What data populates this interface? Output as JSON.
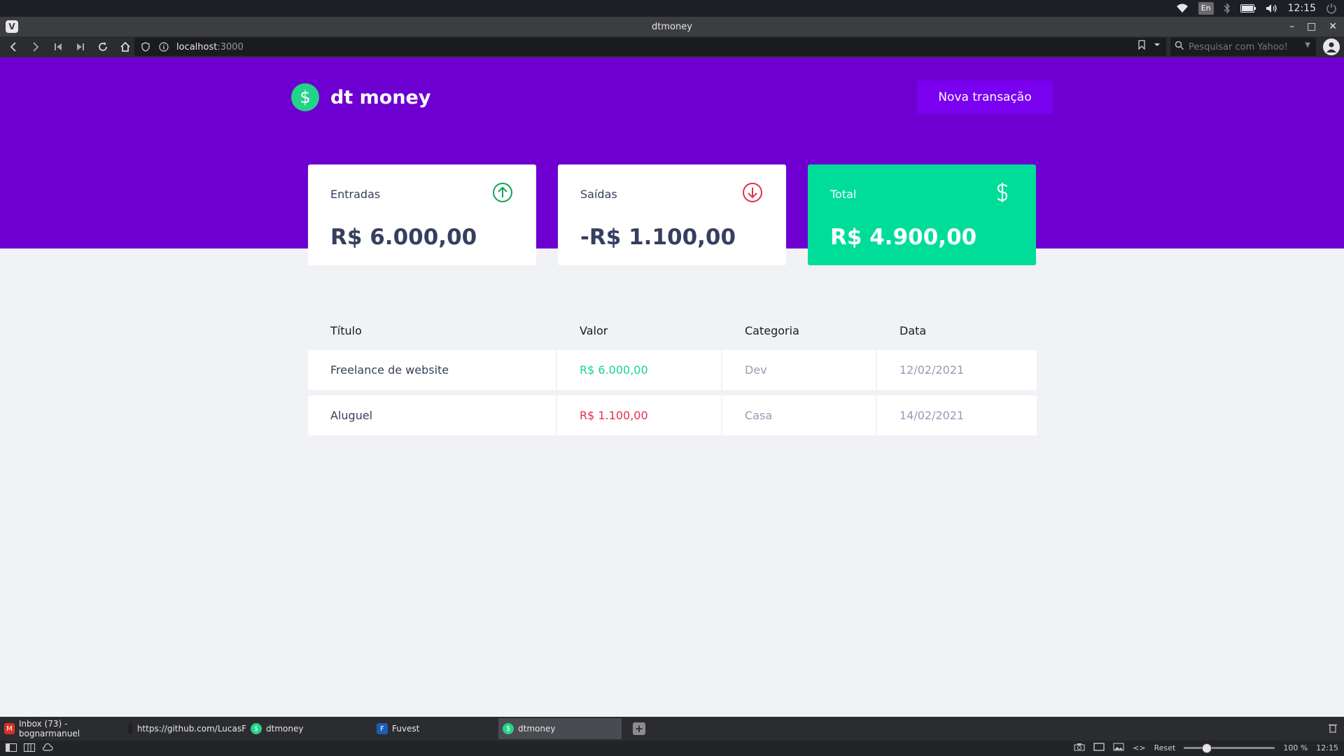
{
  "os": {
    "lang": "En",
    "clock": "12:15"
  },
  "browser": {
    "window_title": "dtmoney",
    "url_host": "localhost",
    "url_port": ":3000",
    "search_placeholder": "Pesquisar com Yahoo!"
  },
  "app": {
    "brand": "dt money",
    "new_transaction_label": "Nova transação",
    "summary": {
      "income": {
        "label": "Entradas",
        "value": "R$ 6.000,00",
        "icon": "arrow-up-circle-icon",
        "color": "#33cc95"
      },
      "outcome": {
        "label": "Saídas",
        "value": "-R$ 1.100,00",
        "icon": "arrow-down-circle-icon",
        "color": "#e52e4d"
      },
      "total": {
        "label": "Total",
        "value": "R$ 4.900,00",
        "icon": "dollar-sign-icon",
        "color": "#00dd99"
      }
    },
    "table": {
      "headers": [
        "Título",
        "Valor",
        "Categoria",
        "Data"
      ],
      "rows": [
        {
          "title": "Freelance de website",
          "amount": "R$ 6.000,00",
          "category": "Dev",
          "date": "12/02/2021",
          "type": "deposit"
        },
        {
          "title": "Aluguel",
          "amount": "R$ 1.100,00",
          "category": "Casa",
          "date": "14/02/2021",
          "type": "withdraw"
        }
      ]
    },
    "colors": {
      "header_purple": "#6d00d0",
      "button_purple": "#7a00f0",
      "green": "#00dd99",
      "red": "#e52e4d",
      "background": "#f0f2f5"
    }
  },
  "tabs": [
    {
      "label": "Inbox (73) - bognarmanuel",
      "icon": "gmail-icon"
    },
    {
      "label": "https://github.com/LucasF",
      "icon": "github-icon"
    },
    {
      "label": "dtmoney",
      "icon": "dtmoney-icon"
    },
    {
      "label": "Fuvest",
      "icon": "fuvest-icon"
    },
    {
      "label": "dtmoney",
      "icon": "dtmoney-icon",
      "active": true
    }
  ],
  "status": {
    "reset_label": "Reset",
    "zoom_percent": 100,
    "zoom_label": "100 %",
    "clock": "12:15"
  }
}
